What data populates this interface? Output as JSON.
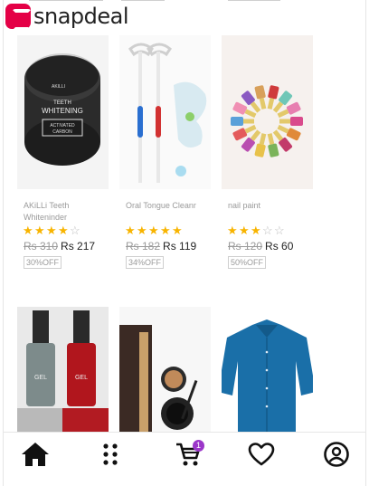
{
  "brand": {
    "name": "snapdeal",
    "accent": "#e40046"
  },
  "products": [
    {
      "title": "AKiLLi Teeth Whiteninder",
      "rating": 4,
      "old_price": "Rs 310",
      "price": "Rs 217",
      "discount": "30%OFF",
      "image": "teeth-whitening-jar",
      "image_text": [
        "TEETH",
        "WHITENING",
        "ACTIVATED",
        "CARBON"
      ]
    },
    {
      "title": "Oral Tongue Cleanr",
      "rating": 5,
      "old_price": "Rs 182",
      "price": "Rs 119",
      "discount": "34%OFF",
      "image": "tongue-cleaner"
    },
    {
      "title": "nail paint",
      "rating": 3,
      "old_price": "Rs 120",
      "price": "Rs 60",
      "discount": "50%OFF",
      "image": "nail-paint-circle"
    },
    {
      "image": "gel-nail-polish",
      "image_text": [
        "GEL",
        "GEL"
      ]
    },
    {
      "image": "eyeliner-gel"
    },
    {
      "image": "blue-shirt"
    }
  ],
  "bottom_nav": {
    "items": [
      "home-icon",
      "categories-icon",
      "cart-icon",
      "wishlist-icon",
      "account-icon"
    ],
    "cart_count": "1",
    "badge_color": "#9b36c9"
  },
  "colors": {
    "star": "#f8b400",
    "star_empty": "#bdbdbd"
  }
}
